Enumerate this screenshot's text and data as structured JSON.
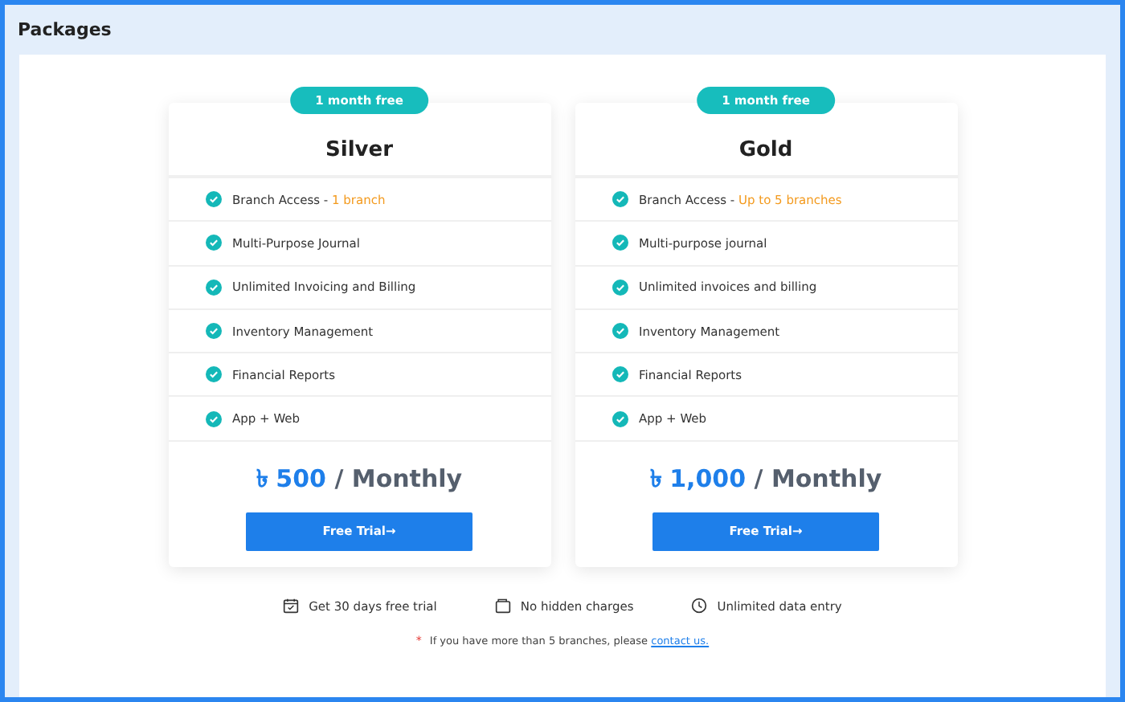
{
  "header": {
    "title": "Packages"
  },
  "plans": [
    {
      "badge": "1 month free",
      "name": "Silver",
      "features": [
        {
          "text": "Branch Access - ",
          "highlight": "1 branch"
        },
        {
          "text": "Multi-Purpose Journal"
        },
        {
          "text": "Unlimited Invoicing and Billing"
        },
        {
          "text": "Inventory Management"
        },
        {
          "text": "Financial Reports"
        },
        {
          "text": "App + Web"
        }
      ],
      "amount": "৳ 500",
      "period": " / Monthly",
      "button": "Free Trial→"
    },
    {
      "badge": "1 month free",
      "name": "Gold",
      "features": [
        {
          "text": "Branch Access - ",
          "highlight": "Up to 5 branches"
        },
        {
          "text": "Multi-purpose journal"
        },
        {
          "text": "Unlimited invoices and billing"
        },
        {
          "text": "Inventory Management"
        },
        {
          "text": "Financial Reports"
        },
        {
          "text": "App + Web"
        }
      ],
      "amount": "৳ 1,000",
      "period": " / Monthly",
      "button": "Free Trial→"
    }
  ],
  "perks": [
    {
      "kind": "calendar",
      "text": "Get 30 days free trial"
    },
    {
      "kind": "wallet",
      "text": "No hidden charges"
    },
    {
      "kind": "clock",
      "text": "Unlimited data entry"
    }
  ],
  "note": {
    "mark": "*",
    "text": "If you have more than 5 branches, please ",
    "link": "contact us."
  }
}
